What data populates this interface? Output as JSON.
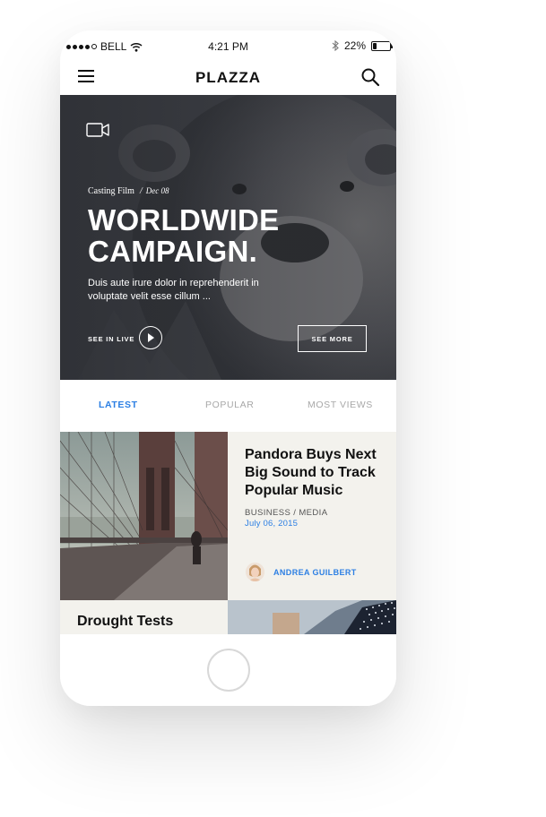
{
  "status_bar": {
    "carrier": "BELL",
    "time": "4:21 PM",
    "battery": "22%",
    "battery_level": 0.22,
    "signal_dots": 5,
    "signal_filled": 4
  },
  "navbar": {
    "logo": "PLAZZA",
    "menu_icon": "hamburger-icon",
    "search_icon": "search-icon"
  },
  "hero": {
    "icon": "video-camera-icon",
    "category": "Casting Film",
    "separator": "/",
    "date": "Dec 08",
    "headline_line1": "WORLDWIDE",
    "headline_line2": "CAMPAIGN.",
    "excerpt": "Duis aute irure dolor in reprehenderit in voluptate velit esse cillum ...",
    "live_label": "SEE IN LIVE",
    "see_more": "SEE MORE"
  },
  "tabs": [
    {
      "label": "LATEST",
      "active": true
    },
    {
      "label": "POPULAR",
      "active": false
    },
    {
      "label": "MOST VIEWS",
      "active": false
    }
  ],
  "articles": [
    {
      "title": "Pandora Buys Next Big Sound to Track Popular Music",
      "category": "BUSINESS / MEDIA",
      "date": "July 06, 2015",
      "author": "ANDREA GUILBERT"
    },
    {
      "title": "Drought Tests"
    }
  ],
  "colors": {
    "accent": "#2c7fe3",
    "card_bg": "#f3f2ed",
    "hero_overlay": "#3d3f44",
    "tab_inactive": "#a8a8a8"
  }
}
